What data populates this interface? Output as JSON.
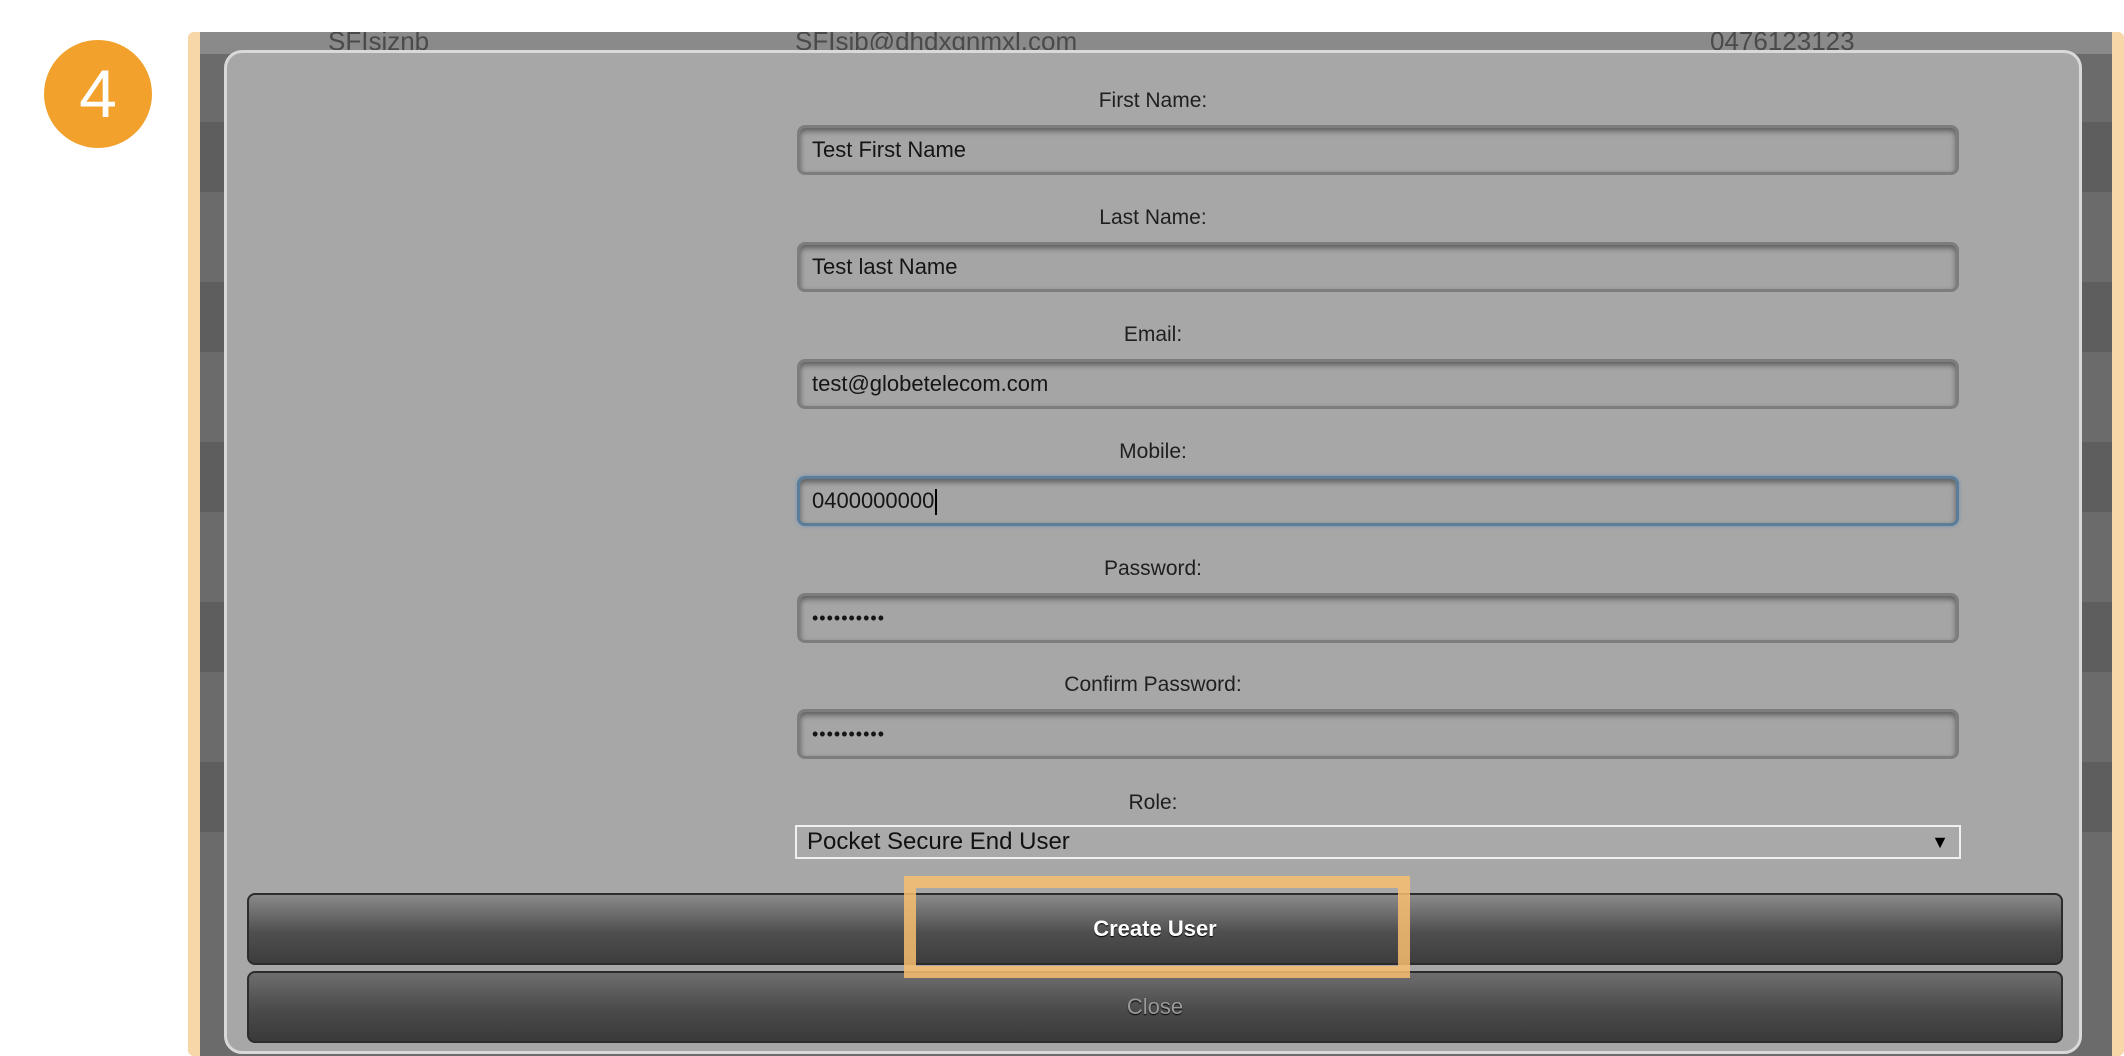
{
  "step_badge": "4",
  "background_row": {
    "cells": [
      "SFIsiznb",
      "SFIsib@dhdxgnmxl.com",
      "0476123123"
    ]
  },
  "form": {
    "first_name": {
      "label": "First Name:",
      "value": "Test First Name"
    },
    "last_name": {
      "label": "Last Name:",
      "value": "Test last Name"
    },
    "email": {
      "label": "Email:",
      "value": "test@globetelecom.com"
    },
    "mobile": {
      "label": "Mobile:",
      "value": "0400000000"
    },
    "password": {
      "label": "Password:",
      "value": "••••••••••"
    },
    "confirm_password": {
      "label": "Confirm Password:",
      "value": "••••••••••"
    },
    "role": {
      "label": "Role:",
      "selected": "Pocket Secure End User"
    }
  },
  "buttons": {
    "create": "Create User",
    "close": "Close"
  },
  "colors": {
    "accent": "#f1a12c",
    "highlight": "#f7be6e",
    "modal_bg": "#a7a7a7"
  },
  "icons": {
    "select_arrow": "▼"
  }
}
